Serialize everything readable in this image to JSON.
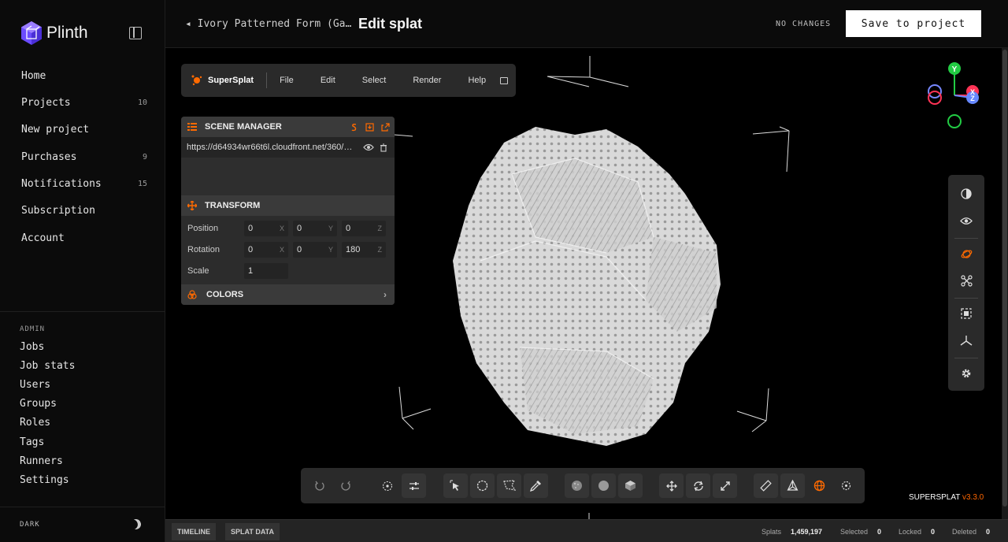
{
  "sidebar": {
    "brand": "Plinth",
    "nav": [
      {
        "label": "Home",
        "count": ""
      },
      {
        "label": "Projects",
        "count": "10"
      },
      {
        "label": "New project",
        "count": ""
      },
      {
        "label": "Purchases",
        "count": "9"
      },
      {
        "label": "Notifications",
        "count": "15"
      },
      {
        "label": "Subscription",
        "count": ""
      },
      {
        "label": "Account",
        "count": ""
      }
    ],
    "admin_label": "ADMIN",
    "admin": [
      "Jobs",
      "Job stats",
      "Users",
      "Groups",
      "Roles",
      "Tags",
      "Runners",
      "Settings"
    ],
    "theme_label": "DARK"
  },
  "header": {
    "back_label": "◂ Ivory Patterned Form (Ga…",
    "title": "Edit splat",
    "changes_status": "NO CHANGES",
    "save_label": "Save to project"
  },
  "menubar": {
    "brand": "SuperSplat",
    "items": [
      "File",
      "Edit",
      "Select",
      "Render",
      "Help"
    ]
  },
  "scene_manager": {
    "title": "SCENE MANAGER",
    "url": "https://d64934wr66t6l.cloudfront.net/360/ga...",
    "transform_title": "TRANSFORM",
    "position_label": "Position",
    "position": [
      "0",
      "0",
      "0"
    ],
    "rotation_label": "Rotation",
    "rotation": [
      "0",
      "0",
      "180"
    ],
    "axes": [
      "X",
      "Y",
      "Z"
    ],
    "scale_label": "Scale",
    "scale": "1",
    "colors_title": "COLORS"
  },
  "gizmo": {
    "y": "Y",
    "x": "X",
    "z": "Z"
  },
  "version": {
    "brand": "SUPERSPLAT ",
    "number": "v3.3.0"
  },
  "statusbar": {
    "tabs": [
      "TIMELINE",
      "SPLAT DATA"
    ],
    "splats_label": "Splats",
    "splats": "1,459,197",
    "selected_label": "Selected",
    "selected": "0",
    "locked_label": "Locked",
    "locked": "0",
    "deleted_label": "Deleted",
    "deleted": "0"
  },
  "colors": {
    "accent": "#ff6a00",
    "brand_purple": "#6b4cff"
  },
  "icons": [
    "logo-cube-icon",
    "sidebar-toggle-icon",
    "moon-icon",
    "supersplat-logo-icon",
    "eye-icon",
    "trash-icon",
    "undo-icon",
    "redo-icon",
    "picker-icon",
    "move-icon",
    "rotate-icon",
    "scale-icon",
    "settings-icon"
  ]
}
